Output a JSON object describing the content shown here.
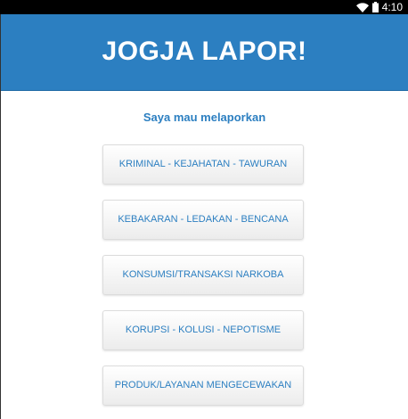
{
  "status_bar": {
    "time": "4:10",
    "icons": [
      "wifi-icon",
      "battery-icon"
    ]
  },
  "header": {
    "title": "JOGJA LAPOR!"
  },
  "main": {
    "prompt": "Saya mau melaporkan",
    "categories": [
      {
        "label": "KRIMINAL - KEJAHATAN - TAWURAN"
      },
      {
        "label": "KEBAKARAN - LEDAKAN - BENCANA"
      },
      {
        "label": "KONSUMSI/TRANSAKSI NARKOBA"
      },
      {
        "label": "KORUPSI - KOLUSI - NEPOTISME"
      },
      {
        "label": "PRODUK/LAYANAN MENGECEWAKAN"
      }
    ]
  },
  "colors": {
    "accent": "#2c7fc1",
    "header_text": "#ffffff",
    "button_background": "#f2f2f2"
  }
}
